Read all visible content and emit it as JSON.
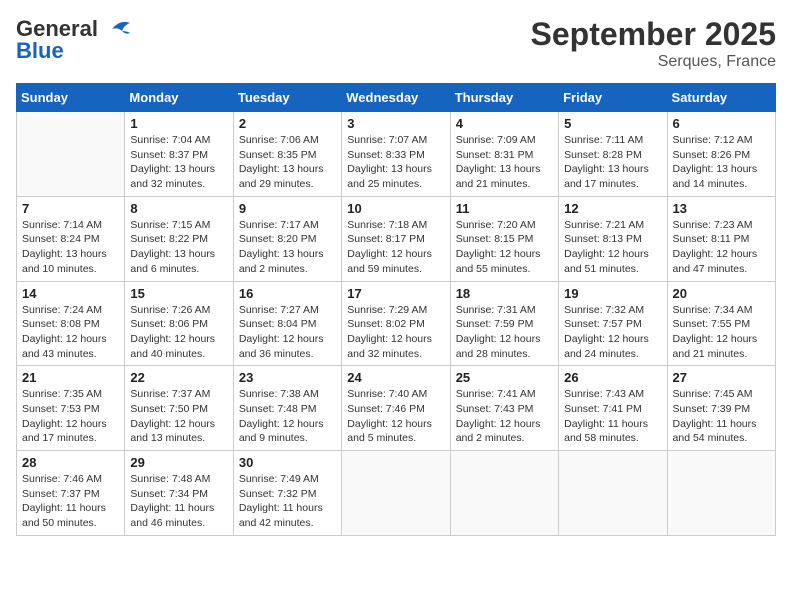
{
  "logo": {
    "line1": "General",
    "line2": "Blue"
  },
  "title": "September 2025",
  "subtitle": "Serques, France",
  "days_header": [
    "Sunday",
    "Monday",
    "Tuesday",
    "Wednesday",
    "Thursday",
    "Friday",
    "Saturday"
  ],
  "weeks": [
    [
      {
        "num": "",
        "info": ""
      },
      {
        "num": "1",
        "info": "Sunrise: 7:04 AM\nSunset: 8:37 PM\nDaylight: 13 hours\nand 32 minutes."
      },
      {
        "num": "2",
        "info": "Sunrise: 7:06 AM\nSunset: 8:35 PM\nDaylight: 13 hours\nand 29 minutes."
      },
      {
        "num": "3",
        "info": "Sunrise: 7:07 AM\nSunset: 8:33 PM\nDaylight: 13 hours\nand 25 minutes."
      },
      {
        "num": "4",
        "info": "Sunrise: 7:09 AM\nSunset: 8:31 PM\nDaylight: 13 hours\nand 21 minutes."
      },
      {
        "num": "5",
        "info": "Sunrise: 7:11 AM\nSunset: 8:28 PM\nDaylight: 13 hours\nand 17 minutes."
      },
      {
        "num": "6",
        "info": "Sunrise: 7:12 AM\nSunset: 8:26 PM\nDaylight: 13 hours\nand 14 minutes."
      }
    ],
    [
      {
        "num": "7",
        "info": "Sunrise: 7:14 AM\nSunset: 8:24 PM\nDaylight: 13 hours\nand 10 minutes."
      },
      {
        "num": "8",
        "info": "Sunrise: 7:15 AM\nSunset: 8:22 PM\nDaylight: 13 hours\nand 6 minutes."
      },
      {
        "num": "9",
        "info": "Sunrise: 7:17 AM\nSunset: 8:20 PM\nDaylight: 13 hours\nand 2 minutes."
      },
      {
        "num": "10",
        "info": "Sunrise: 7:18 AM\nSunset: 8:17 PM\nDaylight: 12 hours\nand 59 minutes."
      },
      {
        "num": "11",
        "info": "Sunrise: 7:20 AM\nSunset: 8:15 PM\nDaylight: 12 hours\nand 55 minutes."
      },
      {
        "num": "12",
        "info": "Sunrise: 7:21 AM\nSunset: 8:13 PM\nDaylight: 12 hours\nand 51 minutes."
      },
      {
        "num": "13",
        "info": "Sunrise: 7:23 AM\nSunset: 8:11 PM\nDaylight: 12 hours\nand 47 minutes."
      }
    ],
    [
      {
        "num": "14",
        "info": "Sunrise: 7:24 AM\nSunset: 8:08 PM\nDaylight: 12 hours\nand 43 minutes."
      },
      {
        "num": "15",
        "info": "Sunrise: 7:26 AM\nSunset: 8:06 PM\nDaylight: 12 hours\nand 40 minutes."
      },
      {
        "num": "16",
        "info": "Sunrise: 7:27 AM\nSunset: 8:04 PM\nDaylight: 12 hours\nand 36 minutes."
      },
      {
        "num": "17",
        "info": "Sunrise: 7:29 AM\nSunset: 8:02 PM\nDaylight: 12 hours\nand 32 minutes."
      },
      {
        "num": "18",
        "info": "Sunrise: 7:31 AM\nSunset: 7:59 PM\nDaylight: 12 hours\nand 28 minutes."
      },
      {
        "num": "19",
        "info": "Sunrise: 7:32 AM\nSunset: 7:57 PM\nDaylight: 12 hours\nand 24 minutes."
      },
      {
        "num": "20",
        "info": "Sunrise: 7:34 AM\nSunset: 7:55 PM\nDaylight: 12 hours\nand 21 minutes."
      }
    ],
    [
      {
        "num": "21",
        "info": "Sunrise: 7:35 AM\nSunset: 7:53 PM\nDaylight: 12 hours\nand 17 minutes."
      },
      {
        "num": "22",
        "info": "Sunrise: 7:37 AM\nSunset: 7:50 PM\nDaylight: 12 hours\nand 13 minutes."
      },
      {
        "num": "23",
        "info": "Sunrise: 7:38 AM\nSunset: 7:48 PM\nDaylight: 12 hours\nand 9 minutes."
      },
      {
        "num": "24",
        "info": "Sunrise: 7:40 AM\nSunset: 7:46 PM\nDaylight: 12 hours\nand 5 minutes."
      },
      {
        "num": "25",
        "info": "Sunrise: 7:41 AM\nSunset: 7:43 PM\nDaylight: 12 hours\nand 2 minutes."
      },
      {
        "num": "26",
        "info": "Sunrise: 7:43 AM\nSunset: 7:41 PM\nDaylight: 11 hours\nand 58 minutes."
      },
      {
        "num": "27",
        "info": "Sunrise: 7:45 AM\nSunset: 7:39 PM\nDaylight: 11 hours\nand 54 minutes."
      }
    ],
    [
      {
        "num": "28",
        "info": "Sunrise: 7:46 AM\nSunset: 7:37 PM\nDaylight: 11 hours\nand 50 minutes."
      },
      {
        "num": "29",
        "info": "Sunrise: 7:48 AM\nSunset: 7:34 PM\nDaylight: 11 hours\nand 46 minutes."
      },
      {
        "num": "30",
        "info": "Sunrise: 7:49 AM\nSunset: 7:32 PM\nDaylight: 11 hours\nand 42 minutes."
      },
      {
        "num": "",
        "info": ""
      },
      {
        "num": "",
        "info": ""
      },
      {
        "num": "",
        "info": ""
      },
      {
        "num": "",
        "info": ""
      }
    ]
  ]
}
